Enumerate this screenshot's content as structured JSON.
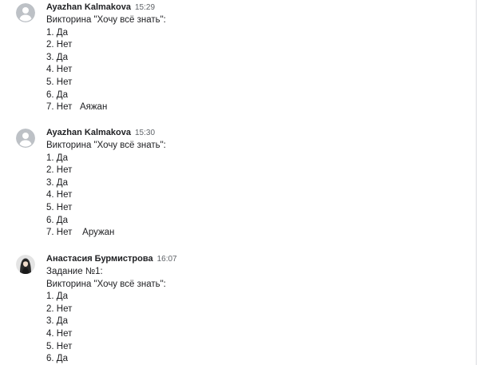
{
  "messages": [
    {
      "author": "Ayazhan Kalmakova",
      "time": "15:29",
      "avatar_icon": "default-user-avatar-icon",
      "lines": [
        "Викторина \"Хочу всё знать\":",
        "1. Да",
        "2. Нет",
        "3. Да",
        "4. Нет",
        "5. Нет",
        "6. Да",
        "7. Нет   Аяжан"
      ]
    },
    {
      "author": "Ayazhan Kalmakova",
      "time": "15:30",
      "avatar_icon": "default-user-avatar-icon",
      "lines": [
        "Викторина \"Хочу всё знать\":",
        "1. Да",
        "2. Нет",
        "3. Да",
        "4. Нет",
        "5. Нет",
        "6. Да",
        "7. Нет    Аружан"
      ]
    },
    {
      "author": "Анастасия Бурмистрова",
      "time": "16:07",
      "avatar_icon": "profile-photo-avatar-icon",
      "lines": [
        "Задание №1:",
        "Викторина \"Хочу всё знать\":",
        "1. Да",
        "2. Нет",
        "3. Да",
        "4. Нет",
        "5. Нет",
        "6. Да"
      ]
    }
  ],
  "colors": {
    "author_text": "#202124",
    "time_text": "#5f6368",
    "body_text": "#202124",
    "default_avatar_bg": "#bdc1c6",
    "default_avatar_fg": "#ffffff",
    "divider": "#dadce0"
  }
}
